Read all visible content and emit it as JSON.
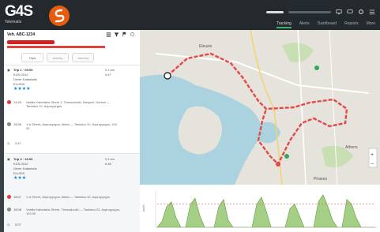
{
  "header": {
    "logo_text": "G4S",
    "logo_sub": "Telematix",
    "nav": [
      "Tracking",
      "Alerts",
      "Dashboard",
      "Reports",
      "More"
    ]
  },
  "sidebar_panel": {
    "title": "Veh. ABC-1234",
    "tabs": [
      "Trips",
      "Activity",
      "Journey"
    ]
  },
  "trips": [
    {
      "title": "Trip 1 · 09:00",
      "line2": "KUS-0012",
      "line3": "Driver Kafantaris",
      "line4": "ELUSIS",
      "distance": "0.1 km",
      "duration": "0:47",
      "events": [
        {
          "time": "14:29",
          "text": "Vasilis Kafantaris Street 1, Thessaloniki, Neapoli, Greece — Tantalou 22, Aspropyrgos"
        },
        {
          "time": "16:06",
          "text": "1 st Street, Aspropyrgos, Attica — Tantalou 22, Aspropyrgos, 193 00"
        }
      ],
      "total": "2:47"
    },
    {
      "title": "Trip 2 · 16:06",
      "line2": "KUS-0012",
      "line3": "Driver Kafantaris",
      "line4": "ELUSIS",
      "distance": "0.1 km",
      "duration": "0:48",
      "events": [
        {
          "time": "18:07",
          "text": "1 st Street, Aspropyrgos, Attica — Tantalou 22, Aspropyrgos"
        },
        {
          "time": "18:08",
          "text": "Vasilis Kafantaris Street, Thessaloniki — Tantalou 22, Aspropyrgos, 193 00"
        }
      ],
      "total": "0:07"
    }
  ],
  "map": {
    "labels": [
      "Eleusis",
      "Athens",
      "Piraeus"
    ]
  },
  "chart_data": {
    "type": "area",
    "ylabel": "km/h",
    "values": [
      0,
      5,
      18,
      22,
      8,
      0,
      0,
      20,
      25,
      10,
      0,
      0,
      0,
      18,
      24,
      6,
      0,
      0,
      0,
      0,
      0,
      20,
      26,
      14,
      0,
      0,
      0,
      0,
      16,
      20,
      10,
      0,
      0,
      0,
      22,
      28,
      18,
      6,
      0,
      0,
      24,
      20,
      8,
      0,
      0,
      0,
      0
    ]
  },
  "colors": {
    "accent": "#e85c0d",
    "route": "#e34848",
    "active_tab": "#35b36a"
  }
}
